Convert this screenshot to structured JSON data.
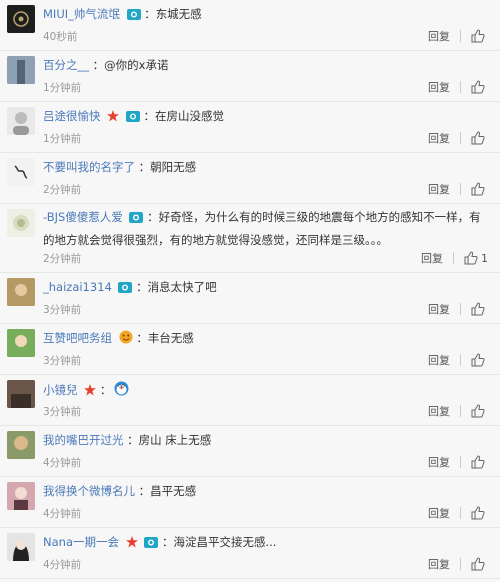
{
  "ui": {
    "reply_label": "回复",
    "colors": {
      "username": "#4a79b8",
      "text": "#333333",
      "time": "#999999",
      "cam_badge": "#22a6c8",
      "star_badge": "#e8402e"
    }
  },
  "comments": [
    {
      "user": "MIUI_帅气流氓",
      "sep": "：",
      "text": "东城无感",
      "time": "40秒前",
      "likes": ""
    },
    {
      "user": "百分之__",
      "sep": "：",
      "text": "@你的x承诺",
      "time": "1分钟前",
      "likes": ""
    },
    {
      "user": "吕途很愉快",
      "sep": "：",
      "text": "在房山没感觉",
      "time": "1分钟前",
      "likes": ""
    },
    {
      "user": "不要叫我的名字了",
      "sep": "：",
      "text": "朝阳无感",
      "time": "2分钟前",
      "likes": ""
    },
    {
      "user": "-BJS傻傻惹人爱",
      "sep": "：",
      "text": "好奇怪，为什么有的时候三级的地震每个地方的感知不一样，有的地方就会觉得很强烈，有的地方就觉得没感觉，还同样是三级。。。",
      "time": "2分钟前",
      "likes": "1"
    },
    {
      "user": "_haizai1314",
      "sep": "：",
      "text": "消息太快了吧",
      "time": "3分钟前",
      "likes": ""
    },
    {
      "user": "互赞吧吧务组",
      "sep": "：",
      "text": "丰台无感",
      "time": "3分钟前",
      "likes": ""
    },
    {
      "user": "小镜兒",
      "sep": "：",
      "text": "",
      "time": "3分钟前",
      "likes": ""
    },
    {
      "user": "我的嘴巴开过光",
      "sep": "：",
      "text": "房山 床上无感",
      "time": "4分钟前",
      "likes": ""
    },
    {
      "user": "我得换个微博名儿",
      "sep": "：",
      "text": "昌平无感",
      "time": "4分钟前",
      "likes": ""
    },
    {
      "user": "Nana一期一会",
      "sep": "：",
      "text": "海淀昌平交接无感...",
      "time": "4分钟前",
      "likes": ""
    }
  ]
}
